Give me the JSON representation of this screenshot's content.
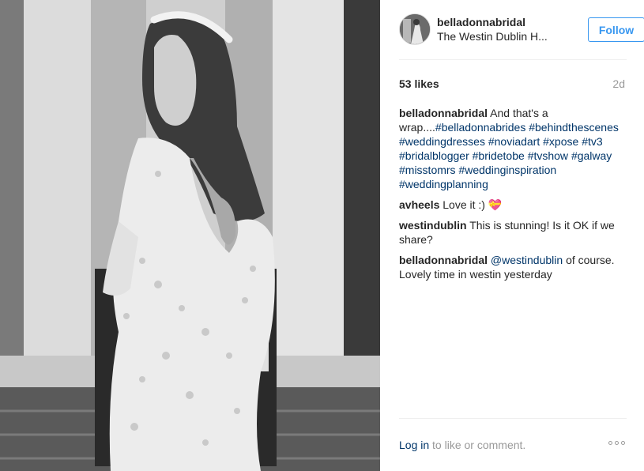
{
  "post": {
    "username": "belladonnabridal",
    "location": "The Westin Dublin H...",
    "follow_label": "Follow",
    "likes": "53 likes",
    "age": "2d"
  },
  "caption": {
    "user": "belladonnabridal",
    "text": "And that's a wrap....",
    "tags": [
      "#belladonnabrides",
      "#behindthescenes",
      "#weddingdresses",
      "#noviadart",
      "#xpose",
      "#tv3",
      "#bridalblogger",
      "#bridetobe",
      "#tvshow",
      "#galway",
      "#misstomrs",
      "#weddinginspiration",
      "#weddingplanning"
    ]
  },
  "comments": [
    {
      "user": "avheels",
      "text": "Love it :) 💝"
    },
    {
      "user": "westindublin",
      "text": "This is stunning! Is it OK if we share?"
    },
    {
      "user": "belladonnabridal",
      "mention": "@westindublin",
      "text": "of course. Lovely time in westin yesterday"
    }
  ],
  "footer": {
    "login_label": "Log in",
    "suffix": "to like or comment."
  },
  "icons": {
    "more": "more-options-icon"
  }
}
